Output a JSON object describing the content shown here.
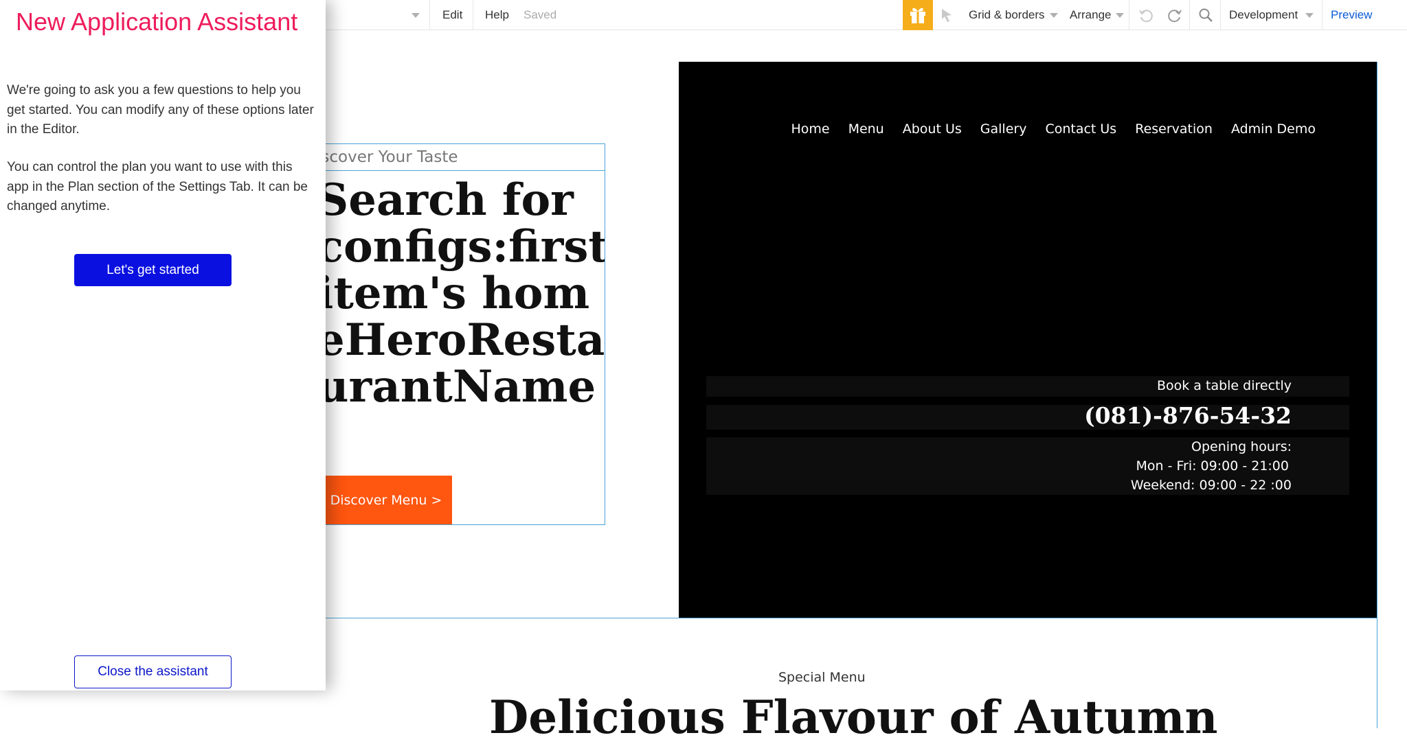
{
  "toolbar": {
    "edit_label": "Edit",
    "help_label": "Help",
    "save_status": "Saved",
    "grid_label": "Grid & borders",
    "arrange_label": "Arrange",
    "environment_label": "Development",
    "preview_label": "Preview",
    "gift_color": "#f6ad1a"
  },
  "assistant": {
    "title": "New Application Assistant",
    "intro": "We're going to ask you a few questions to help you get started. You can modify any of these options later in the Editor.",
    "plan_note": "You can control the plan you want to use with this app in the Plan section of the Settings Tab. It can be changed anytime.",
    "start_label": "Let's get started",
    "close_label": "Close the assistant",
    "title_color": "#ee1c5b",
    "button_color": "#0a10e0"
  },
  "site": {
    "nav": [
      "Home",
      "Menu",
      "About Us",
      "Gallery",
      "Contact Us",
      "Reservation",
      "Admin Demo"
    ],
    "hero": {
      "eyebrow": "iscover Your Taste",
      "heading": "Search for configs:first item's homeHeroRestaurantName",
      "cta": "Discover Menu >",
      "cta_color": "#ff5610"
    },
    "booking": {
      "label": "Book a table directly",
      "phone": "(081)-876-54-32",
      "hours_title": "Opening hours:",
      "weekday": "Mon - Fri: 09:00 - 21:00",
      "weekend": "Weekend: 09:00 - 22 :00"
    },
    "special": {
      "label": "Special Menu",
      "heading": "Delicious Flavour of Autumn"
    }
  }
}
